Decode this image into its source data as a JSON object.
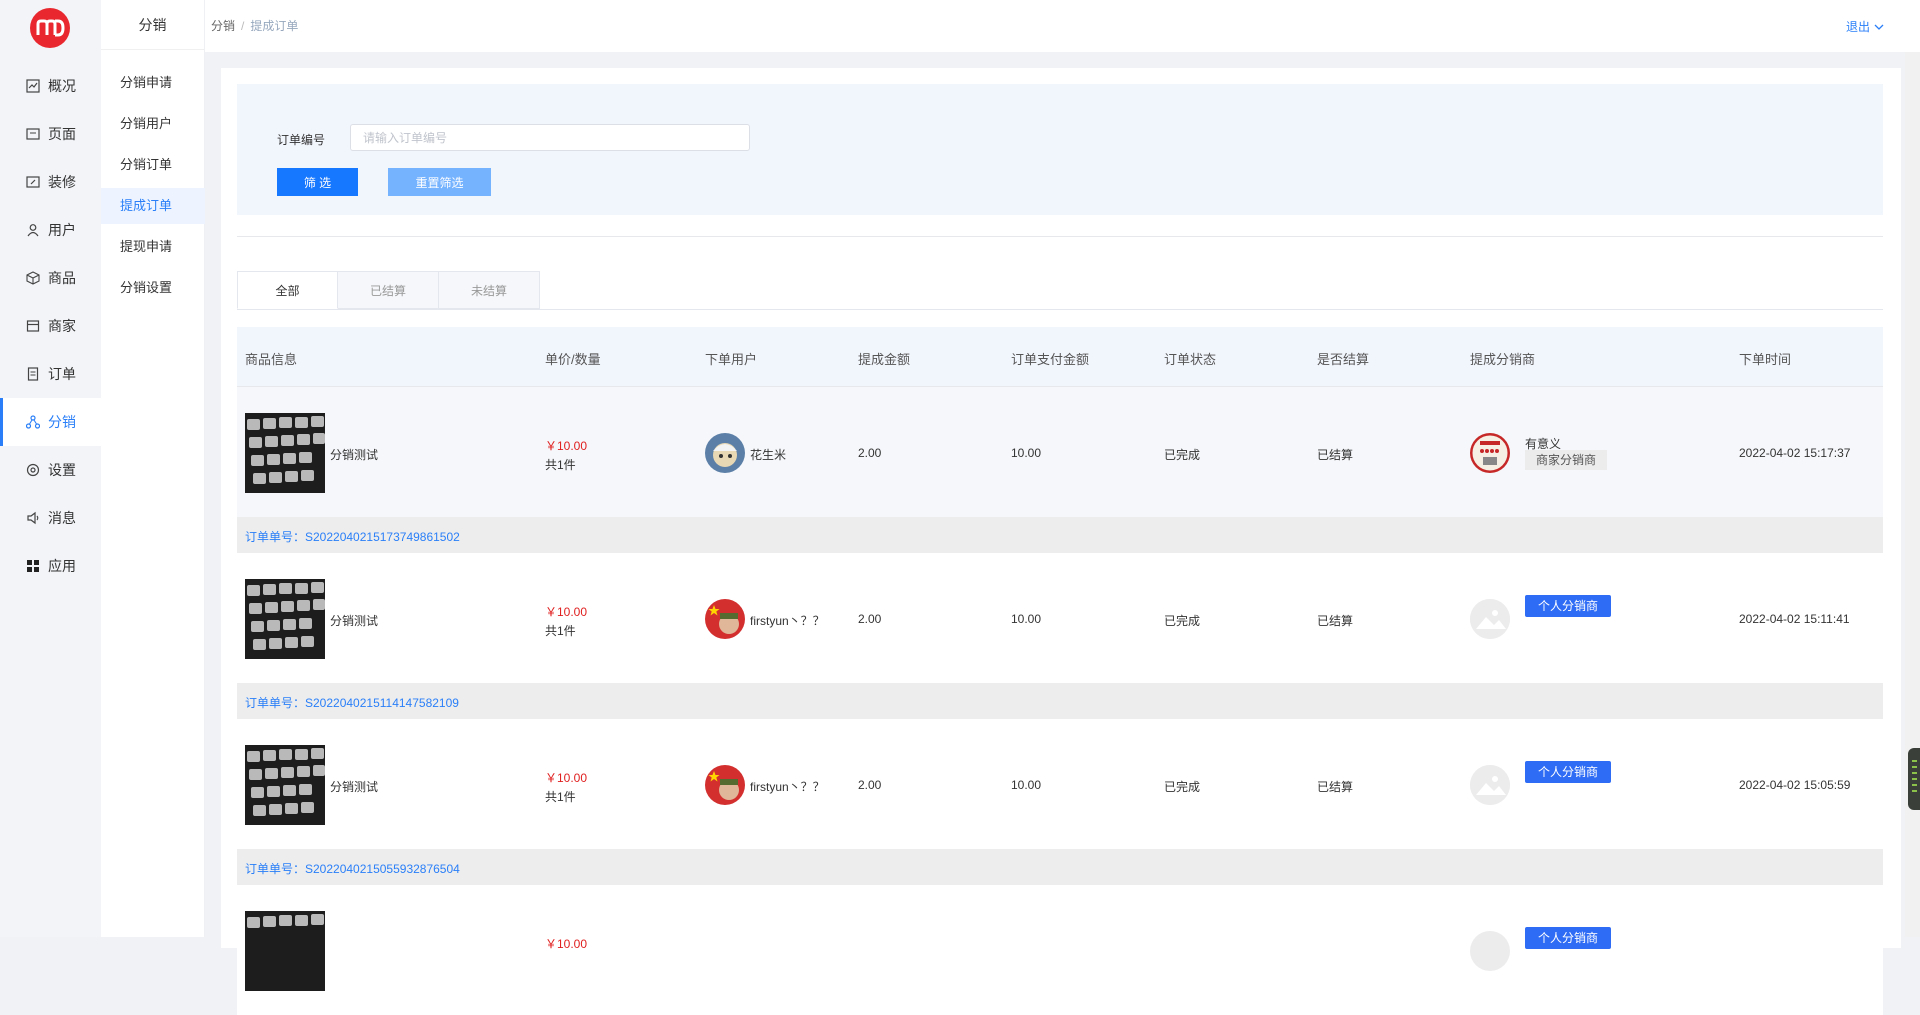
{
  "rail": {
    "items": [
      {
        "label": "概况",
        "icon": "chart-icon"
      },
      {
        "label": "页面",
        "icon": "page-icon"
      },
      {
        "label": "装修",
        "icon": "decorate-icon"
      },
      {
        "label": "用户",
        "icon": "user-icon"
      },
      {
        "label": "商品",
        "icon": "box-icon"
      },
      {
        "label": "商家",
        "icon": "store-icon"
      },
      {
        "label": "订单",
        "icon": "order-icon"
      },
      {
        "label": "分销",
        "icon": "distribution-icon"
      },
      {
        "label": "设置",
        "icon": "gear-icon"
      },
      {
        "label": "消息",
        "icon": "speaker-icon"
      },
      {
        "label": "应用",
        "icon": "apps-grid-icon"
      }
    ],
    "active_index": 7,
    "logo_color": "#e8282e"
  },
  "submenu": {
    "title": "分销",
    "items": [
      "分销申请",
      "分销用户",
      "分销订单",
      "提成订单",
      "提现申请",
      "分销设置"
    ],
    "active_index": 3
  },
  "header": {
    "breadcrumb": [
      "分销",
      "提成订单"
    ],
    "logout": "退出"
  },
  "filter": {
    "label": "订单编号",
    "placeholder": "请输入订单编号",
    "submit": "筛 选",
    "reset": "重置筛选"
  },
  "tabs": [
    "全部",
    "已结算",
    "未结算"
  ],
  "table": {
    "headers": [
      "商品信息",
      "单价/数量",
      "下单用户",
      "提成金额",
      "订单支付金额",
      "订单状态",
      "是否结算",
      "提成分销商",
      "下单时间"
    ],
    "rows": [
      {
        "product": "分销测试",
        "price": "￥10.00",
        "qty": "共1件",
        "user": "花生米",
        "commission": "2.00",
        "pay": "10.00",
        "status": "已完成",
        "settled": "已结算",
        "dist_name": "有意义",
        "dist_tag": "商家分销商",
        "time": "2022-04-02 15:17:37",
        "order_no": "订单单号：S2022040215173749861502"
      },
      {
        "product": "分销测试",
        "price": "￥10.00",
        "qty": "共1件",
        "user": "firstyun丶？？",
        "commission": "2.00",
        "pay": "10.00",
        "status": "已完成",
        "settled": "已结算",
        "dist_tag": "个人分销商",
        "time": "2022-04-02 15:11:41",
        "order_no": "订单单号：S2022040215114147582109"
      },
      {
        "product": "分销测试",
        "price": "￥10.00",
        "qty": "共1件",
        "user": "firstyun丶？？",
        "commission": "2.00",
        "pay": "10.00",
        "status": "已完成",
        "settled": "已结算",
        "dist_tag": "个人分销商",
        "time": "2022-04-02 15:05:59",
        "order_no": "订单单号：S2022040215055932876504"
      },
      {
        "product": "",
        "price": "￥10.00",
        "qty": "",
        "user": "",
        "dist_tag": "个人分销商"
      }
    ]
  },
  "colors": {
    "accent": "#2a7ff8",
    "primary_button": "#1677ff",
    "price": "#e02020",
    "tag_blue": "#2e6cf5"
  }
}
